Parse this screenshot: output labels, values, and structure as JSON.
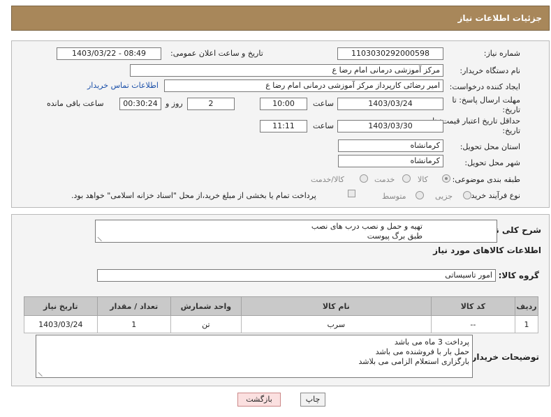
{
  "header": {
    "title": "جزئیات اطلاعات نیاز"
  },
  "form": {
    "need_number_label": "شماره نیاز:",
    "need_number": "1103030292000598",
    "announce_label": "تاریخ و ساعت اعلان عمومی:",
    "announce_value": "1403/03/22 - 08:49",
    "buyer_org_label": "نام دستگاه خریدار:",
    "buyer_org": "مرکز آموزشی  درمانی امام رضا  ع",
    "creator_label": "ایجاد کننده درخواست:",
    "creator": "امیر رضائی کارپرداز مرکز آموزشی  درمانی امام رضا  ع",
    "contact_link": "اطلاعات تماس خریدار",
    "deadline_label": "مهلت ارسال پاسخ: تا تاریخ:",
    "deadline_date": "1403/03/24",
    "time_label": "ساعت",
    "deadline_time": "10:00",
    "days_value": "2",
    "days_label": "روز و",
    "remaining_time": "00:30:24",
    "remaining_label": "ساعت باقی مانده",
    "validity_label": "حداقل تاریخ اعتبار قیمت: تا تاریخ:",
    "validity_date": "1403/03/30",
    "validity_time": "11:11",
    "province_label": "استان محل تحویل:",
    "province": "کرمانشاه",
    "city_label": "شهر محل تحویل:",
    "city": "کرمانشاه",
    "category_label": "طبقه بندی موضوعی:",
    "category_options": [
      "کالا",
      "خدمت",
      "کالا/خدمت"
    ],
    "process_label": "نوع فرآیند خرید :",
    "process_options": [
      "جزیی",
      "متوسط"
    ],
    "payment_note": "پرداخت تمام یا بخشی از مبلغ خرید،از محل \"اسناد خزانه اسلامی\" خواهد بود."
  },
  "details": {
    "desc_label": "شرح کلی نیاز:",
    "desc_lines": [
      "تهیه و حمل و نصب درب های نصب",
      "طبق برگ پیوست"
    ],
    "goods_title": "اطلاعات کالاهای مورد نیاز",
    "group_label": "گروه کالا:",
    "group_value": "امور تاسیساتی",
    "table": {
      "headers": [
        "ردیف",
        "کد کالا",
        "نام کالا",
        "واحد شمارش",
        "تعداد / مقدار",
        "تاریخ نیاز"
      ],
      "rows": [
        [
          "1",
          "--",
          "سرب",
          "تن",
          "1",
          "1403/03/24"
        ]
      ]
    },
    "notes_label": "توضیحات خریدار:",
    "notes_lines": [
      "پرداخت 3 ماه می باشد",
      "حمل بار با فروشنده می باشد",
      "بارگزاری استعلام الزامی می بلاشد"
    ]
  },
  "buttons": {
    "print": "چاپ",
    "back": "بازگشت"
  }
}
